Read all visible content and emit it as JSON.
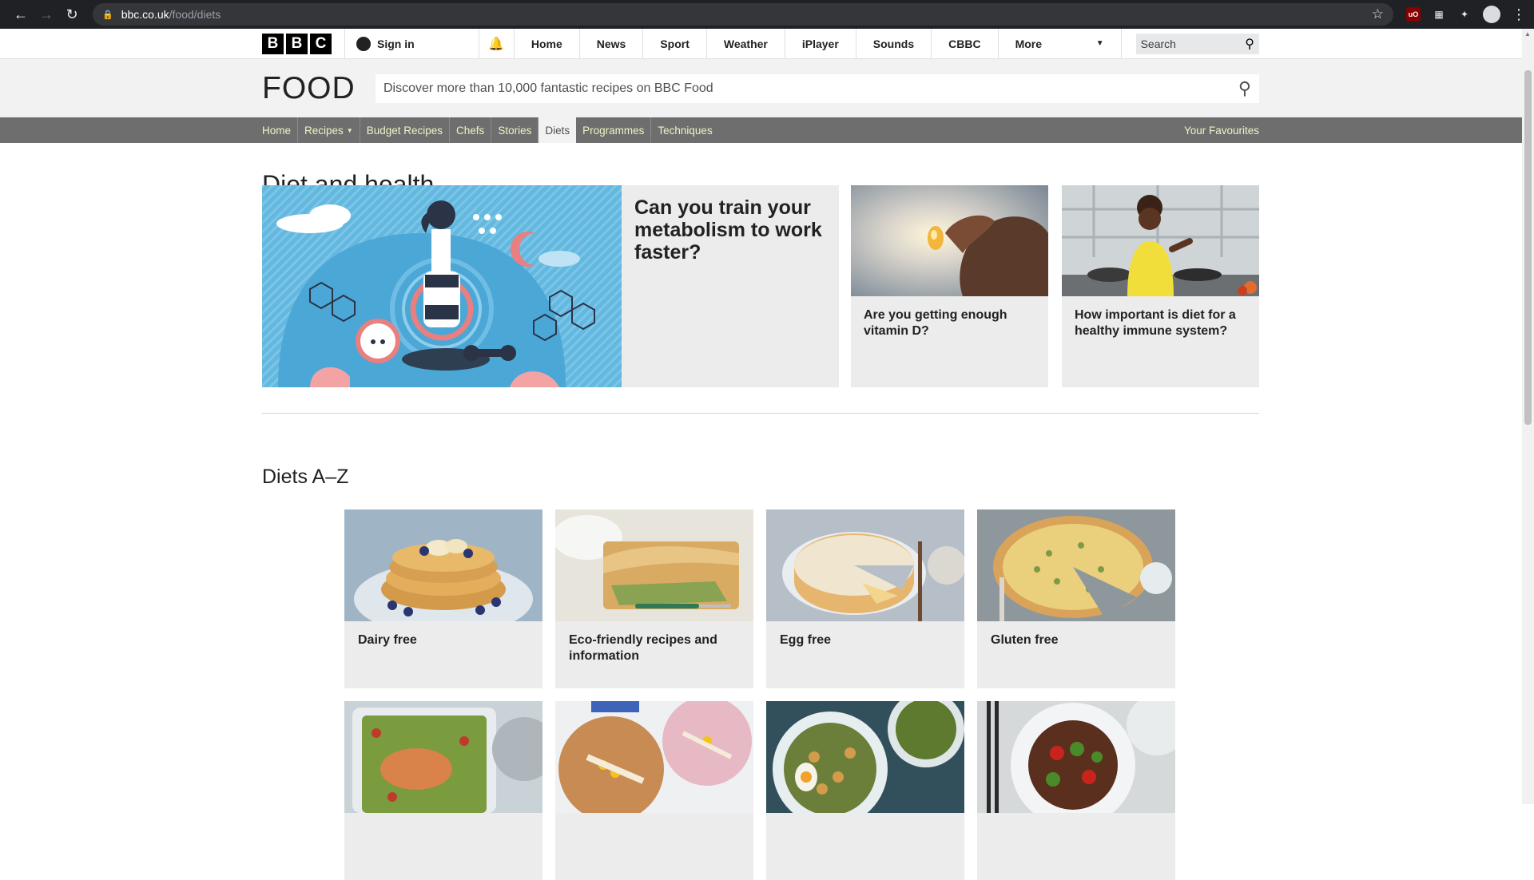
{
  "browser": {
    "url_host": "bbc.co.uk",
    "url_path": "/food/diets"
  },
  "global_nav": {
    "sign_in": "Sign in",
    "items": [
      "Home",
      "News",
      "Sport",
      "Weather",
      "iPlayer",
      "Sounds",
      "CBBC"
    ],
    "more": "More",
    "search_placeholder": "Search"
  },
  "food": {
    "logo": "FOOD",
    "search_placeholder": "Discover more than 10,000 fantastic recipes on BBC Food",
    "nav": {
      "home": "Home",
      "recipes": "Recipes",
      "budget": "Budget Recipes",
      "chefs": "Chefs",
      "stories": "Stories",
      "diets": "Diets",
      "programmes": "Programmes",
      "techniques": "Techniques",
      "favourites": "Your Favourites"
    }
  },
  "page": {
    "title": "Diet and health",
    "featured": {
      "main": "Can you train your metabolism to work faster?",
      "cards": [
        "Are you getting enough vitamin D?",
        "How important is diet for a healthy immune system?"
      ]
    },
    "az_title": "Diets A–Z",
    "diets": [
      "Dairy free",
      "Eco-friendly recipes and information",
      "Egg free",
      "Gluten free",
      "",
      "",
      "",
      ""
    ]
  },
  "colors": {
    "nav_bg": "#6e6e6e",
    "nav_link": "#e9f6c4",
    "card_bg": "#ececec"
  }
}
